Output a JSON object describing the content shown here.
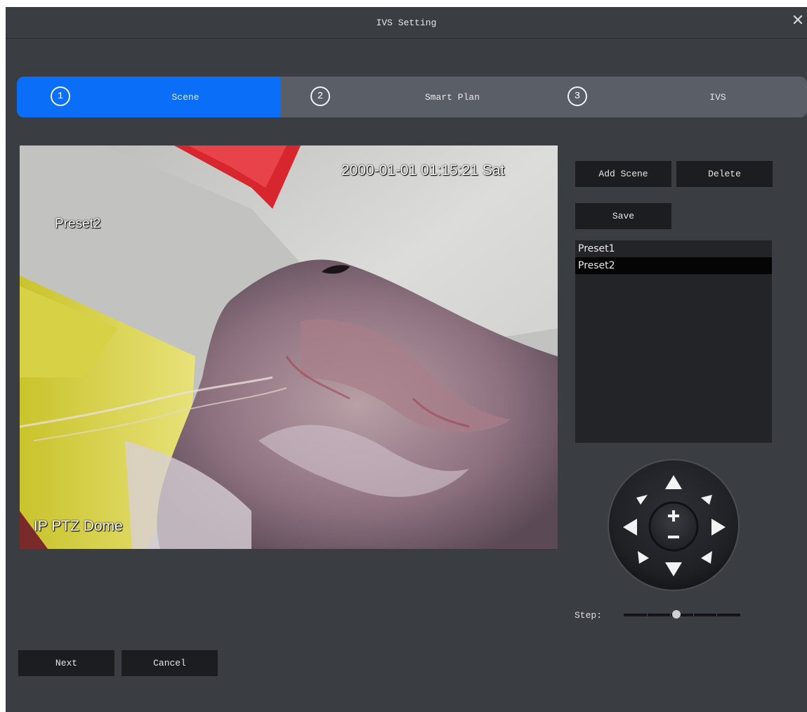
{
  "window": {
    "title": "IVS Setting"
  },
  "steps": [
    {
      "number": "1",
      "label": "Scene",
      "active": true
    },
    {
      "number": "2",
      "label": "Smart Plan",
      "active": false
    },
    {
      "number": "3",
      "label": "IVS",
      "active": false
    }
  ],
  "video": {
    "timestamp": "2000-01-01 01:15:21 Sat",
    "preset_osd": "Preset2",
    "camera_name": "IP PTZ Dome"
  },
  "scene_buttons": {
    "add": "Add Scene",
    "delete": "Delete",
    "save": "Save"
  },
  "presets": [
    {
      "label": "Preset1",
      "selected": false
    },
    {
      "label": "Preset2",
      "selected": true
    }
  ],
  "ptz": {
    "icons": [
      "arrow-up-icon",
      "arrow-down-icon",
      "arrow-left-icon",
      "arrow-right-icon",
      "arrow-up-left-icon",
      "arrow-up-right-icon",
      "arrow-down-left-icon",
      "arrow-down-right-icon",
      "zoom-in-icon",
      "zoom-out-icon"
    ]
  },
  "step_control": {
    "label": "Step:",
    "value_fraction": 0.45
  },
  "footer": {
    "next": "Next",
    "cancel": "Cancel"
  },
  "colors": {
    "accent": "#0a6ef8",
    "background": "#3a3d42",
    "button": "#1c1d20"
  }
}
